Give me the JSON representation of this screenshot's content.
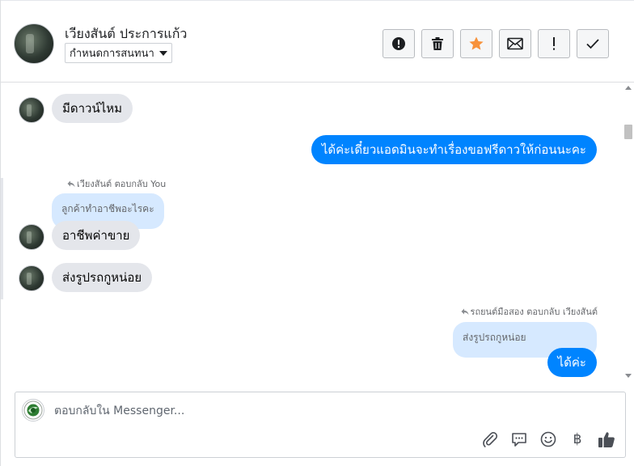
{
  "header": {
    "contact_name": "เวียงสันต์ ประการแก้ว",
    "label_select_value": "กำหนดการสนทนา",
    "actions": [
      {
        "name": "mark-spam-button",
        "icon": "exclamation-circle-icon"
      },
      {
        "name": "delete-button",
        "icon": "trash-icon"
      },
      {
        "name": "star-button",
        "icon": "star-icon"
      },
      {
        "name": "mark-unread-button",
        "icon": "envelope-icon"
      },
      {
        "name": "flag-button",
        "icon": "exclamation-icon"
      },
      {
        "name": "mark-done-button",
        "icon": "check-icon"
      }
    ],
    "star_color": "#f7923b"
  },
  "messages": {
    "m1": "มีดาวน์ไหม",
    "m2": "ได้ค่ะเดี๋ยวแอดมินจะทำเรื่องขอฟรีดาวให้ก่อนนะคะ",
    "reply1_meta": "เวียงสันต์ ตอบกลับ You",
    "reply1_quote": "ลูกค้าทำอาชีพอะไรคะ",
    "m3": "อาชีพค่าขาย",
    "m4": "ส่งรูปรถกูหน่อย",
    "reply2_meta": "รถยนต์มือสอง ตอบกลับ เวียงสันต์",
    "reply2_quote": "ส่งรูปรถกูหน่อย",
    "m5": "ได้ค่ะ"
  },
  "composer": {
    "placeholder": "ตอบกลับใน Messenger...",
    "tools": [
      "paperclip-icon",
      "saved-reply-icon",
      "emoji-icon",
      "baht-icon",
      "thumbs-up-icon"
    ],
    "baht_symbol": "฿"
  },
  "colors": {
    "outgoing": "#0084ff",
    "incoming": "#e4e6eb",
    "quote": "#d6e9ff"
  }
}
